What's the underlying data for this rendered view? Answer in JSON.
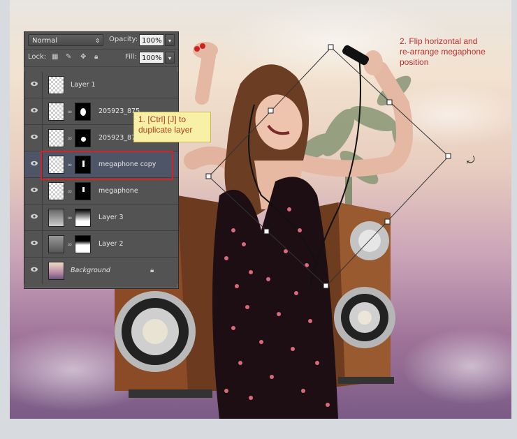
{
  "panel": {
    "blend_mode": "Normal",
    "opacity_label": "Opacity:",
    "opacity_value": "100%",
    "lock_label": "Lock:",
    "fill_label": "Fill:",
    "fill_value": "100%",
    "layers": [
      {
        "name": "Layer 1",
        "has_mask": false,
        "italic": false,
        "selected": false
      },
      {
        "name": "205923_875",
        "has_mask": true,
        "italic": false,
        "selected": false
      },
      {
        "name": "205923_875",
        "has_mask": true,
        "italic": false,
        "selected": false
      },
      {
        "name": "megaphone copy",
        "has_mask": true,
        "italic": false,
        "selected": true
      },
      {
        "name": "megaphone",
        "has_mask": true,
        "italic": false,
        "selected": false
      },
      {
        "name": "Layer 3",
        "has_mask": true,
        "italic": false,
        "selected": false
      },
      {
        "name": "Layer 2",
        "has_mask": true,
        "italic": false,
        "selected": false
      },
      {
        "name": "Background",
        "has_mask": false,
        "italic": true,
        "selected": false,
        "locked": true
      }
    ]
  },
  "annotations": {
    "step1_line1": "1. [Ctrl] [J] to",
    "step1_line2": "duplicate layer",
    "step2_line1": "2. Flip horizontal and",
    "step2_line2": "re-arrange megaphone",
    "step2_line3": "position"
  },
  "colors": {
    "highlight": "#d2232a",
    "annotation_text": "#c0302f",
    "note_bg": "#f8f0a6"
  }
}
